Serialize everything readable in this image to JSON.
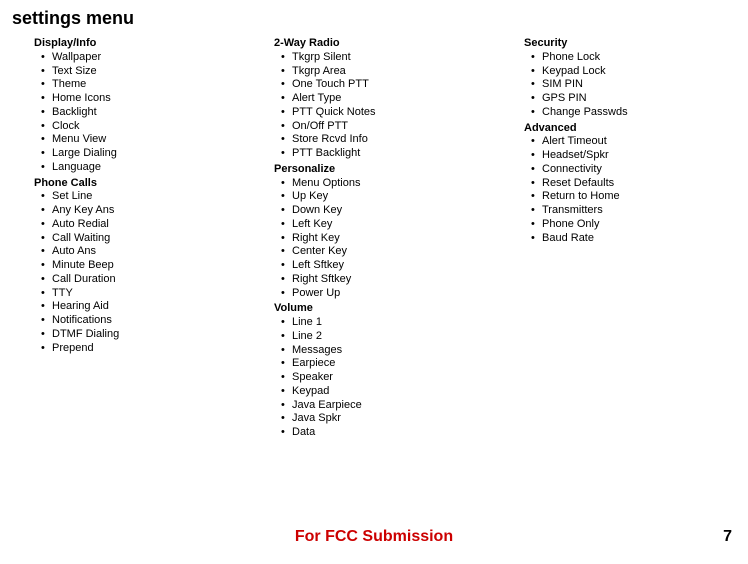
{
  "title": "settings menu",
  "footer": "For FCC Submission",
  "page_number": "7",
  "col1": [
    {
      "heading": "Display/Info",
      "items": [
        "Wallpaper",
        "Text Size",
        "Theme",
        "Home Icons",
        "Backlight",
        "Clock",
        "Menu View",
        "Large Dialing",
        "Language"
      ]
    },
    {
      "heading": "Phone Calls",
      "items": [
        "Set Line",
        "Any Key Ans",
        "Auto Redial",
        "Call Waiting",
        "Auto Ans",
        "Minute Beep",
        "Call Duration",
        "TTY",
        "Hearing Aid",
        "Notifications",
        "DTMF Dialing",
        "Prepend"
      ]
    }
  ],
  "col2": [
    {
      "heading": "2-Way Radio",
      "items": [
        "Tkgrp Silent",
        "Tkgrp Area",
        "One Touch PTT",
        "Alert Type",
        "PTT Quick Notes",
        "On/Off PTT",
        "Store Rcvd Info",
        "PTT Backlight"
      ]
    },
    {
      "heading": "Personalize",
      "items": [
        "Menu Options",
        "Up Key",
        "Down Key",
        "Left Key",
        "Right Key",
        "Center Key",
        "Left Sftkey",
        "Right Sftkey",
        "Power Up"
      ]
    },
    {
      "heading": "Volume",
      "items": [
        "Line 1",
        "Line 2",
        "Messages",
        "Earpiece",
        "Speaker",
        "Keypad",
        "Java Earpiece",
        "Java Spkr",
        "Data"
      ]
    }
  ],
  "col3": [
    {
      "heading": "Security",
      "items": [
        "Phone Lock",
        "Keypad Lock",
        "SIM PIN",
        "GPS PIN",
        "Change Passwds"
      ]
    },
    {
      "heading": "Advanced",
      "items": [
        "Alert Timeout",
        "Headset/Spkr",
        "Connectivity",
        "Reset Defaults",
        "Return to Home",
        "Transmitters",
        "Phone Only",
        "Baud Rate"
      ]
    }
  ]
}
